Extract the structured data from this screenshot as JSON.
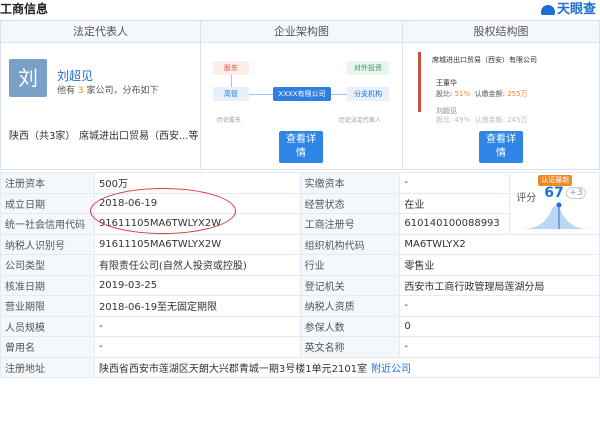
{
  "header": {
    "title": "工商信息",
    "brand": "天眼查"
  },
  "panels": {
    "legal_rep": {
      "heading": "法定代表人",
      "avatar_char": "刘",
      "name": "刘超见",
      "sub_prefix": "他有",
      "sub_count": "3",
      "sub_suffix": "家公司，分布如下",
      "region": "陕西（共3家）",
      "company": "席城进出口贸易（西安...等"
    },
    "org": {
      "heading": "企业架构图",
      "shareholder": "股东",
      "executive": "高管",
      "center": "XXXX有限公司",
      "invest": "对外投资",
      "branch": "分支机构",
      "history_shareholder": "历史股东",
      "history_rep": "历史法定代表人",
      "detail_btn_l1": "查看详",
      "detail_btn_l2": "情"
    },
    "equity": {
      "heading": "股权结构图",
      "company": "席城进出口贸易（西安）有限公司",
      "holder1": "王董华",
      "ratio_label": "股比:",
      "ratio1": "51%",
      "amount_label": "认缴金额:",
      "amount1": "255万",
      "holder2": "刘超见",
      "ratio2": "49%",
      "amount2": "245万",
      "detail_btn_l1": "查看详",
      "detail_btn_l2": "情"
    }
  },
  "score": {
    "badge": "认证最新",
    "label": "评分",
    "value": "67",
    "plus": "+3"
  },
  "table": {
    "rows": [
      {
        "l1": "注册资本",
        "v1": "500万",
        "l2": "实缴资本",
        "v2": "-"
      },
      {
        "l1": "成立日期",
        "v1": "2018-06-19",
        "l2": "经营状态",
        "v2": "在业"
      },
      {
        "l1": "统一社会信用代码",
        "v1": "91611105MA6TWLYX2W",
        "l2": "工商注册号",
        "v2": "610140100088993"
      },
      {
        "l1": "纳税人识别号",
        "v1": "91611105MA6TWLYX2W",
        "l2": "组织机构代码",
        "v2": "MA6TWLYX2"
      },
      {
        "l1": "公司类型",
        "v1": "有限责任公司(自然人投资或控股)",
        "l2": "行业",
        "v2": "零售业"
      },
      {
        "l1": "核准日期",
        "v1": "2019-03-25",
        "l2": "登记机关",
        "v2": "西安市工商行政管理局莲湖分局"
      },
      {
        "l1": "营业期限",
        "v1": "2018-06-19至无固定期限",
        "l2": "纳税人资质",
        "v2": "-"
      },
      {
        "l1": "人员规模",
        "v1": "-",
        "l2": "参保人数",
        "v2": "0"
      },
      {
        "l1": "曾用名",
        "v1": "-",
        "l2": "英文名称",
        "v2": "-"
      },
      {
        "l1": "注册地址",
        "v1": "陕西省西安市莲湖区天朗大兴郡青城一期3号楼1单元2101室",
        "link": "附近公司"
      }
    ]
  },
  "colors": {
    "accent": "#1f6fd1",
    "button": "#2f86e6",
    "highlight": "#d63a3a",
    "score_badge": "#f08a24"
  }
}
